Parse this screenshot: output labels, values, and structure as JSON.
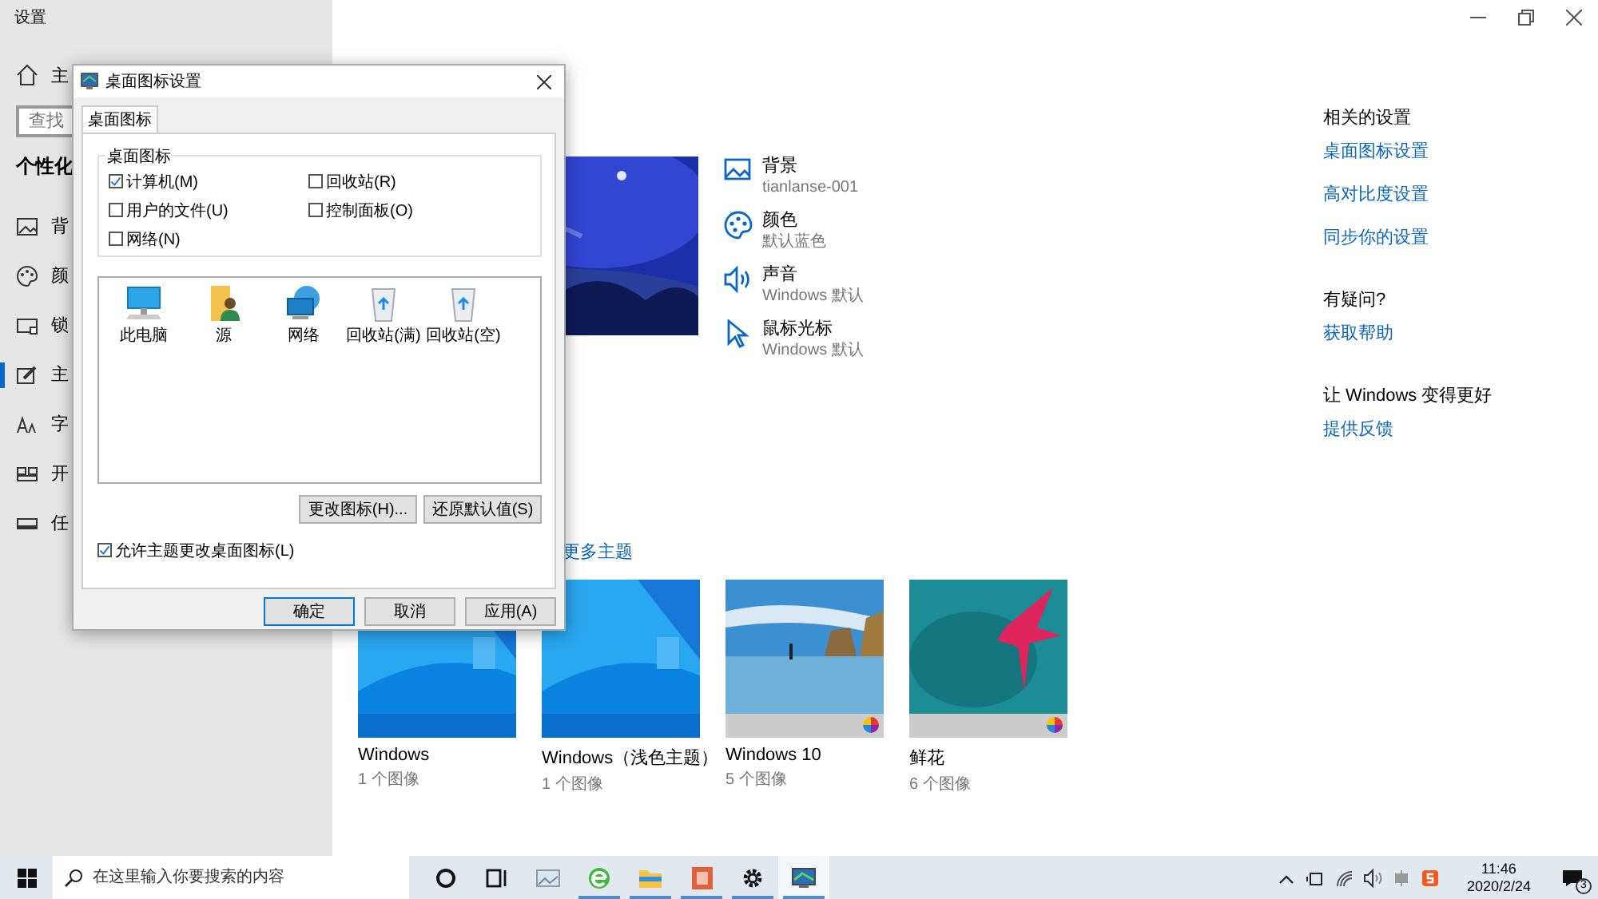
{
  "settings_window": {
    "title": "设置",
    "home": "主",
    "search_placeholder": "查找",
    "heading": "个性化",
    "sidebar_items": [
      {
        "label": "背",
        "kind": "background",
        "selected": false
      },
      {
        "label": "颜",
        "kind": "color",
        "selected": false
      },
      {
        "label": "锁",
        "kind": "lock",
        "selected": false
      },
      {
        "label": "主",
        "kind": "theme",
        "selected": true
      },
      {
        "label": "字",
        "kind": "font",
        "selected": false
      },
      {
        "label": "开",
        "kind": "start",
        "selected": false
      },
      {
        "label": "任",
        "kind": "taskbar",
        "selected": false
      }
    ]
  },
  "attributes": [
    {
      "kind": "background",
      "title": "背景",
      "value": "tianlanse-001"
    },
    {
      "kind": "color",
      "title": "颜色",
      "value": "默认蓝色"
    },
    {
      "kind": "sound",
      "title": "声音",
      "value": "Windows 默认"
    },
    {
      "kind": "cursor",
      "title": "鼠标光标",
      "value": "Windows 默认"
    }
  ],
  "more_themes_link": "更多主题",
  "themes": [
    {
      "kind": "windows",
      "name": "Windows",
      "count": "1 个图像"
    },
    {
      "kind": "windows",
      "name": "Windows（浅色主题）",
      "count": "1 个图像"
    },
    {
      "kind": "beach",
      "name": "Windows 10",
      "count": "5 个图像"
    },
    {
      "kind": "flower",
      "name": "鲜花",
      "count": "6 个图像"
    }
  ],
  "related": {
    "heading": "相关的设置",
    "links": [
      "桌面图标设置",
      "高对比度设置",
      "同步你的设置"
    ]
  },
  "help": {
    "heading": "有疑问?",
    "links": [
      "获取帮助"
    ]
  },
  "feedback": {
    "heading": "让 Windows 变得更好",
    "links": [
      "提供反馈"
    ]
  },
  "dialog": {
    "title": "桌面图标设置",
    "tab": {
      "label": "桌面图标",
      "selected": true
    },
    "group_label": "桌面图标",
    "checkboxes": [
      {
        "label": "计算机(M)",
        "checked": true
      },
      {
        "label": "回收站(R)",
        "checked": false
      },
      {
        "label": "用户的文件(U)",
        "checked": false
      },
      {
        "label": "控制面板(O)",
        "checked": false
      },
      {
        "label": "网络(N)",
        "checked": false
      }
    ],
    "icons": [
      {
        "kind": "computer",
        "label": "此电脑",
        "selected": false
      },
      {
        "kind": "user",
        "label": "源",
        "selected": false
      },
      {
        "kind": "network",
        "label": "网络",
        "selected": false
      },
      {
        "kind": "bin",
        "label": "回收站(满)",
        "selected": false
      },
      {
        "kind": "bin",
        "label": "回收站(空)",
        "selected": false
      }
    ],
    "buttons": [
      "更改图标(H)...",
      "还原默认值(S)"
    ],
    "allow": {
      "label": "允许主题更改桌面图标(L)",
      "checked": true
    },
    "footer_buttons": [
      {
        "label": "确定",
        "default": true
      },
      {
        "label": "取消",
        "default": false
      },
      {
        "label": "应用(A)",
        "default": false
      }
    ]
  },
  "taskbar": {
    "search_placeholder": "在这里输入你要搜索的内容",
    "apps": [
      {
        "kind": "cortana",
        "running": false,
        "active": false
      },
      {
        "kind": "taskview",
        "running": false,
        "active": false
      },
      {
        "kind": "photos",
        "running": false,
        "active": false
      },
      {
        "kind": "browser",
        "running": true,
        "active": false
      },
      {
        "kind": "folder",
        "running": true,
        "active": false
      },
      {
        "kind": "slides",
        "running": true,
        "active": false
      },
      {
        "kind": "gear",
        "running": true,
        "active": false
      },
      {
        "kind": "display",
        "running": true,
        "active": true
      }
    ],
    "time": "11:46",
    "date": "2020/2/24",
    "notifications": "3"
  }
}
